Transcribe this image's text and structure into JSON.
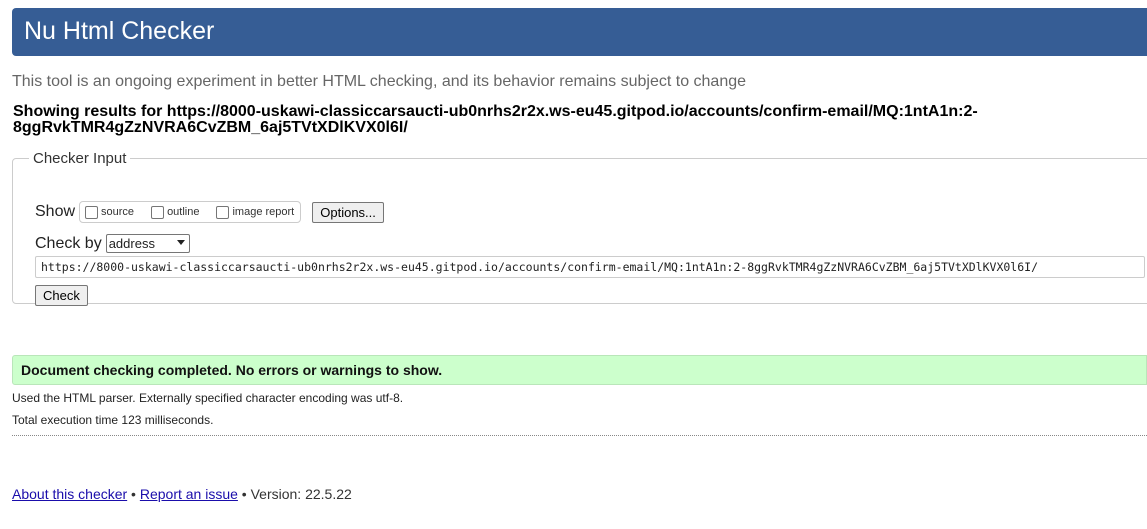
{
  "header": {
    "title": "Nu Html Checker"
  },
  "intro": "This tool is an ongoing experiment in better HTML checking, and its behavior remains subject to change",
  "showing": "Showing results for https://8000-uskawi-classiccarsaucti-ub0nrhs2r2x.ws-eu45.gitpod.io/accounts/confirm-email/MQ:1ntA1n:2-8ggRvkTMR4gZzNVRA6CvZBM_6aj5TVtXDlKVX0l6I/",
  "checker_input": {
    "legend": "Checker Input",
    "show_label": "Show",
    "options": [
      "source",
      "outline",
      "image report"
    ],
    "options_button": "Options...",
    "check_by_label": "Check by",
    "check_by_value": "address",
    "url_value": "https://8000-uskawi-classiccarsaucti-ub0nrhs2r2x.ws-eu45.gitpod.io/accounts/confirm-email/MQ:1ntA1n:2-8ggRvkTMR4gZzNVRA6CvZBM_6aj5TVtXDlKVX0l6I/",
    "check_button": "Check"
  },
  "result": {
    "success_message": "Document checking completed. No errors or warnings to show.",
    "parser_info": "Used the HTML parser. Externally specified character encoding was utf-8.",
    "timing_info": "Total execution time 123 milliseconds."
  },
  "footer": {
    "about_link": "About this checker",
    "separator": " • ",
    "report_link": "Report an issue",
    "version": " • Version: 22.5.22"
  }
}
